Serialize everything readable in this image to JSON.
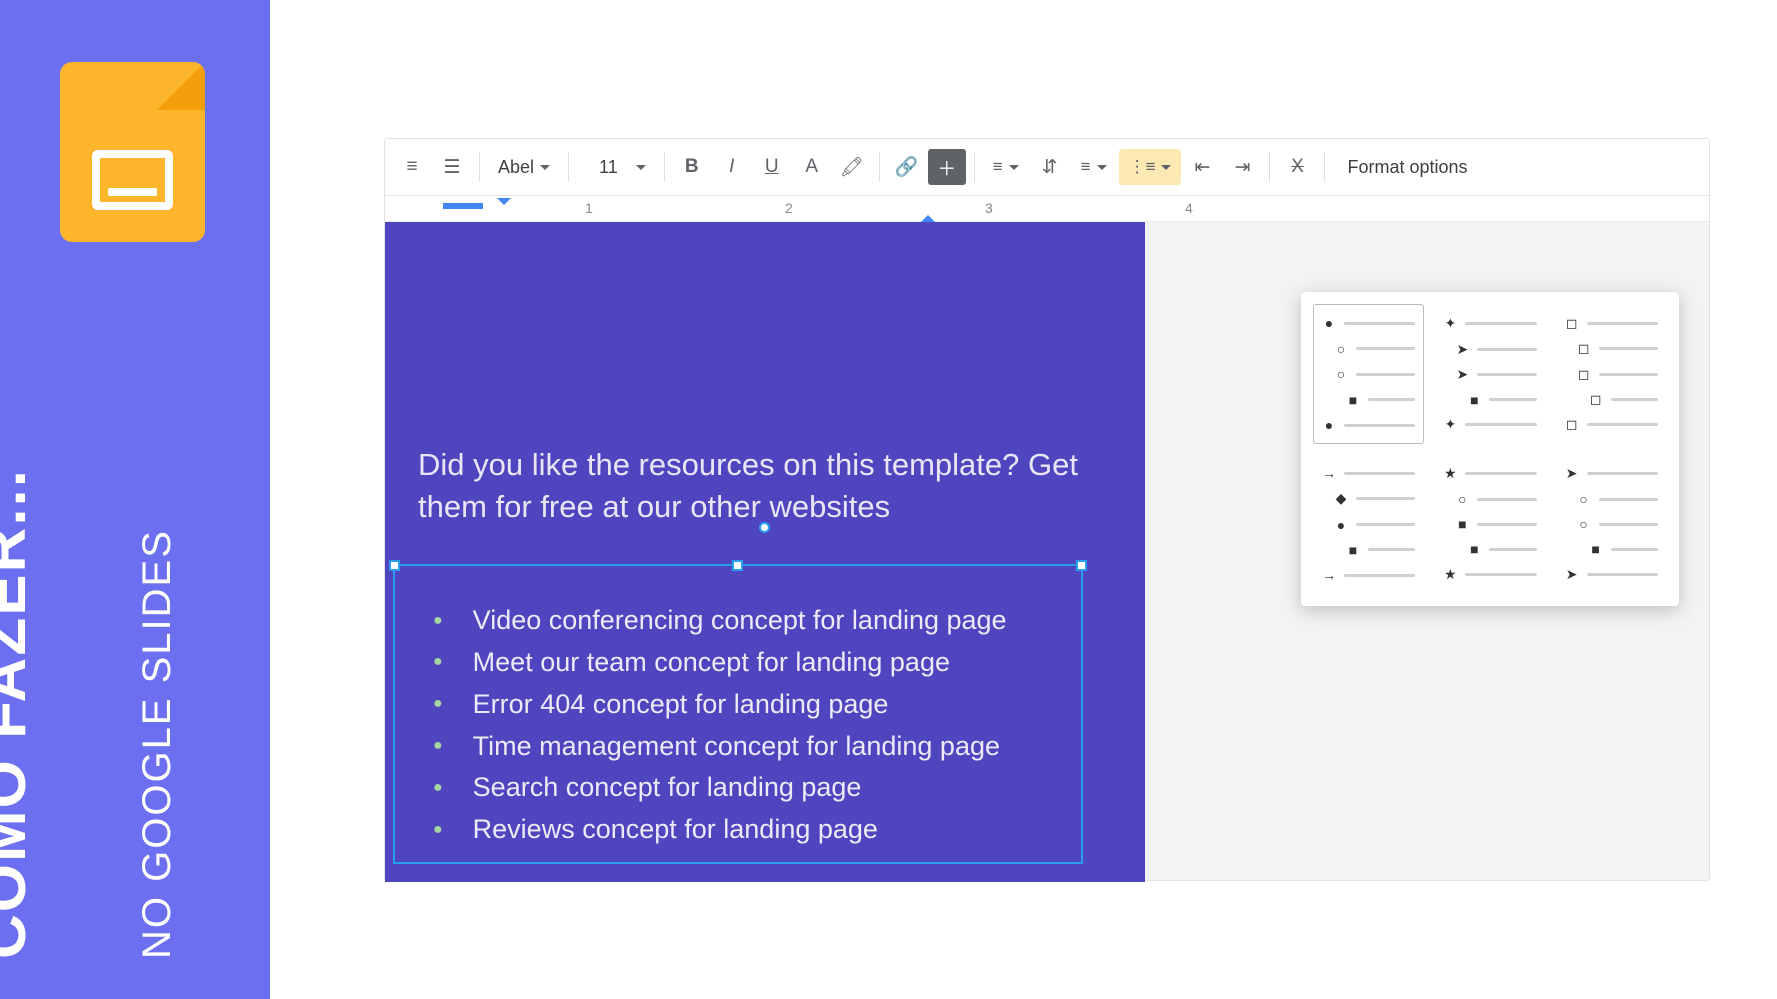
{
  "leftPanel": {
    "main": "COMO FAZER...",
    "sub": "NO GOOGLE SLIDES"
  },
  "toolbar": {
    "fontName": "Abel",
    "fontSize": "11",
    "formatOptions": "Format options"
  },
  "ruler": {
    "marks": [
      "1",
      "2",
      "3",
      "4"
    ]
  },
  "slide": {
    "title": "Did you like the resources on this template? Get them for free at our other websites",
    "bullets": [
      "Video conferencing concept for landing page",
      "Meet our team concept for landing page",
      "Error 404 concept for landing page",
      "Time management concept for landing page",
      "Search concept for landing page",
      "Reviews concept for landing page"
    ]
  },
  "bulletOptions": [
    {
      "id": "disc-circle-square",
      "marks": [
        "●",
        "○",
        "○",
        "■",
        "●"
      ],
      "selected": true
    },
    {
      "id": "diamond-arrow",
      "marks": [
        "✦",
        "➤",
        "➤",
        "■",
        "✦"
      ],
      "selected": false
    },
    {
      "id": "square-outline",
      "marks": [
        "◻",
        "◻",
        "◻",
        "◻",
        "◻"
      ],
      "selected": false
    },
    {
      "id": "arrow-diamond",
      "marks": [
        "→",
        "◆",
        "●",
        "■",
        "→"
      ],
      "selected": false
    },
    {
      "id": "star-circle",
      "marks": [
        "★",
        "○",
        "■",
        "■",
        "★"
      ],
      "selected": false
    },
    {
      "id": "chevron-circle",
      "marks": [
        "➤",
        "○",
        "○",
        "■",
        "➤"
      ],
      "selected": false
    }
  ]
}
